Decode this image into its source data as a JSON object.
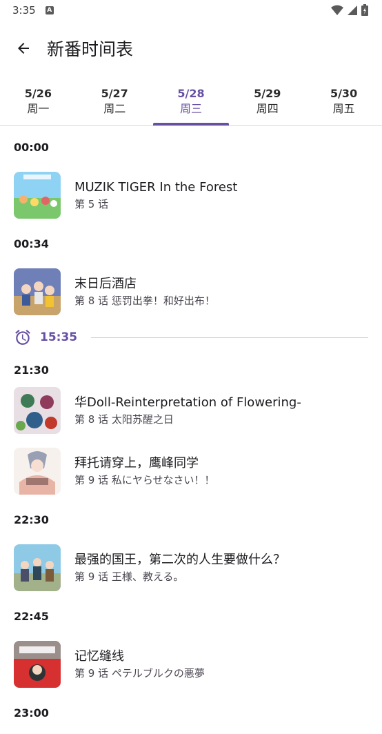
{
  "status": {
    "time": "3:35",
    "notif_letter": "A"
  },
  "app_bar": {
    "title": "新番时间表"
  },
  "tabs": [
    {
      "date": "5/26",
      "day": "周一"
    },
    {
      "date": "5/27",
      "day": "周二"
    },
    {
      "date": "5/28",
      "day": "周三"
    },
    {
      "date": "5/29",
      "day": "周四"
    },
    {
      "date": "5/30",
      "day": "周五"
    }
  ],
  "now_marker": {
    "time": "15:35",
    "icon": "alarm-clock-icon"
  },
  "schedule": [
    {
      "time": "00:00",
      "title": "MUZIK TIGER In the Forest",
      "episode": "第 5 话"
    },
    {
      "time": "00:34",
      "title": "末日后酒店",
      "episode": "第 8 话  惩罚出拳！和好出布！"
    },
    {
      "time": "21:30",
      "title": "华Doll-Reinterpretation of Flowering-",
      "episode": "第 8 话  太阳苏醒之日"
    },
    {
      "time": "",
      "title": "拜托请穿上，鹰峰同学",
      "episode": "第 9 话  私にヤらせなさい！！"
    },
    {
      "time": "22:30",
      "title": "最强的国王，第二次的人生要做什么？",
      "episode": "第 9 话  王様、教える。"
    },
    {
      "time": "22:45",
      "title": "记忆缝线",
      "episode": "第 9 话  ペテルブルクの悪夢"
    },
    {
      "time": "23:00",
      "title": "",
      "episode": ""
    }
  ],
  "colors": {
    "accent": "#6750a4",
    "divider": "#d9d9d9"
  }
}
